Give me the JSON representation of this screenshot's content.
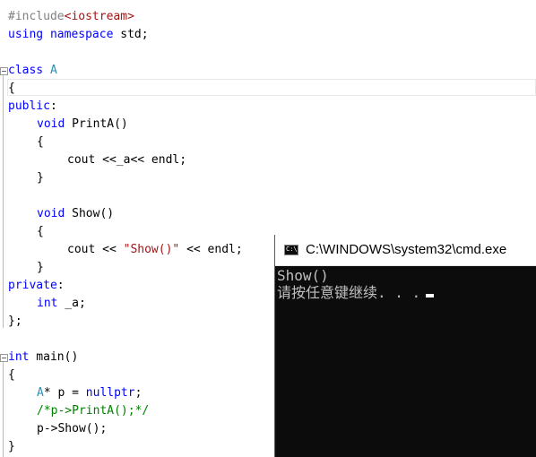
{
  "editor": {
    "lines": {
      "l1": {
        "pp": "#include",
        "rest": "<iostream>"
      },
      "l2": {
        "kw1": "using",
        "kw2": "namespace",
        "rest": " std;"
      },
      "l4": {
        "kw": "class",
        "name": "A"
      },
      "l5": "{",
      "l6": {
        "kw": "public",
        "rest": ":"
      },
      "l7": {
        "kw": "void",
        "rest": " PrintA()"
      },
      "l8": "{",
      "l9": "cout <<_a<< endl;",
      "l10": "}",
      "l12": {
        "kw": "void",
        "rest": " Show()"
      },
      "l13": "{",
      "l14": {
        "a": "cout << ",
        "str": "\"Show()\"",
        "b": " << endl;"
      },
      "l15": "}",
      "l16": {
        "kw": "private",
        "rest": ":"
      },
      "l17": {
        "kw": "int",
        "rest": " _a;"
      },
      "l18": "};",
      "l20": {
        "kw": "int",
        "rest": " main()"
      },
      "l21": "{",
      "l22": {
        "cls": "A",
        "a": "* p = ",
        "kw": "nullptr",
        "b": ";"
      },
      "l23": "/*p->PrintA();*/",
      "l24": "p->Show();",
      "l25": "}"
    }
  },
  "cmd": {
    "title": "C:\\WINDOWS\\system32\\cmd.exe",
    "icon_text": "C:\\.",
    "output_line1": "Show()",
    "output_line2": "请按任意键继续. . ."
  },
  "colors": {
    "keyword": "#0000ff",
    "type": "#2b91af",
    "string": "#a31515",
    "comment": "#008000",
    "console_bg": "#0c0c0c",
    "console_text": "#c0c0c0"
  }
}
